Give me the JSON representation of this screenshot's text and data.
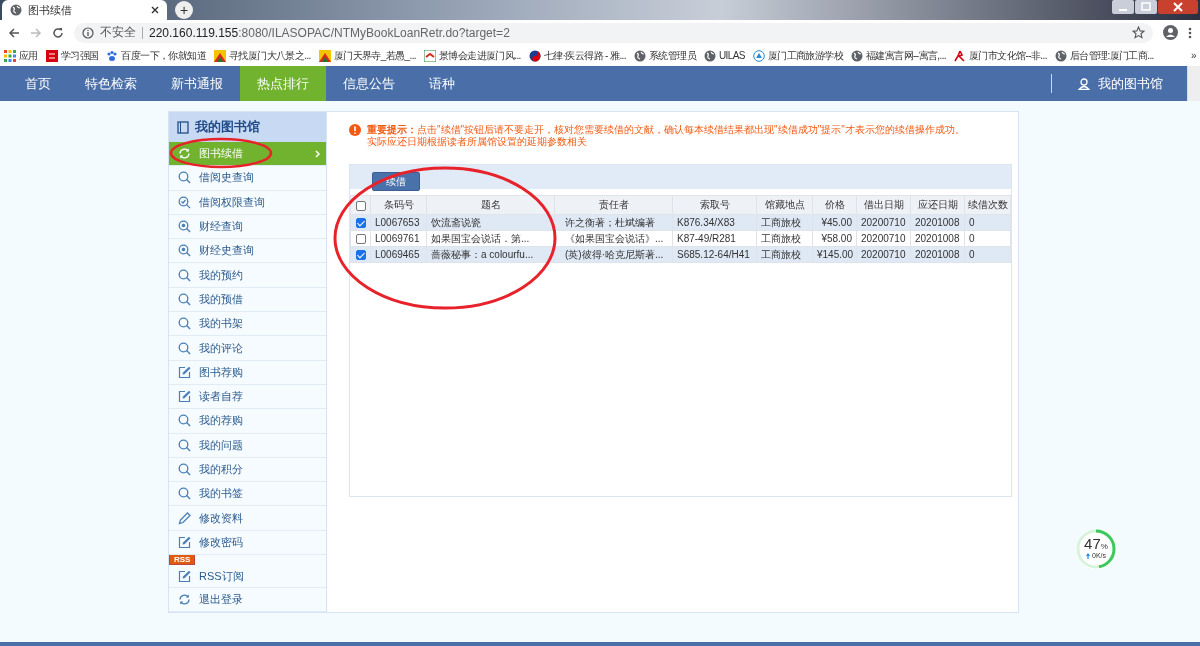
{
  "browser": {
    "tab_title": "图书续借",
    "new_tab": "+",
    "security": "不安全",
    "url_host": "220.160.119.155",
    "url_rest": ":8080/ILASOPAC/NTMyBookLoanRetr.do?target=2",
    "bookmarks": [
      {
        "label": "应用",
        "kind": "apps"
      },
      {
        "label": "学习强国",
        "kind": "red"
      },
      {
        "label": "百度一下，你就知道",
        "kind": "paw"
      },
      {
        "label": "寻找厦门大八景之...",
        "kind": "flag"
      },
      {
        "label": "厦门天界寺_若愚_...",
        "kind": "flag"
      },
      {
        "label": "景博会走进厦门风...",
        "kind": "green"
      },
      {
        "label": "七律·疾云得路 - 雅...",
        "kind": "swirl"
      },
      {
        "label": "系统管理员",
        "kind": "globe"
      },
      {
        "label": "UILAS",
        "kind": "globe"
      },
      {
        "label": "厦门工商旅游学校",
        "kind": "school"
      },
      {
        "label": "福建寓言网--寓言,...",
        "kind": "globe"
      },
      {
        "label": "厦门市文化馆--非...",
        "kind": "redlogo"
      },
      {
        "label": "后台管理:厦门工商...",
        "kind": "globe"
      }
    ],
    "overflow": "»"
  },
  "nav": {
    "items": [
      {
        "label": "首页",
        "selected": false
      },
      {
        "label": "特色检索",
        "selected": false
      },
      {
        "label": "新书通报",
        "selected": false
      },
      {
        "label": "热点排行",
        "selected": true
      },
      {
        "label": "信息公告",
        "selected": false
      },
      {
        "label": "语种",
        "selected": false
      }
    ],
    "account": "我的图书馆"
  },
  "sidebar": {
    "title": "我的图书馆",
    "items": [
      {
        "label": "图书续借",
        "kind": "renew",
        "selected": true
      },
      {
        "label": "借阅史查询",
        "kind": "search",
        "selected": false
      },
      {
        "label": "借阅权限查询",
        "kind": "check",
        "selected": false
      },
      {
        "label": "财经查询",
        "kind": "record",
        "selected": false
      },
      {
        "label": "财经史查询",
        "kind": "record",
        "selected": false
      },
      {
        "label": "我的预约",
        "kind": "search",
        "selected": false
      },
      {
        "label": "我的预借",
        "kind": "search",
        "selected": false
      },
      {
        "label": "我的书架",
        "kind": "search",
        "selected": false
      },
      {
        "label": "我的评论",
        "kind": "search",
        "selected": false
      },
      {
        "label": "图书荐购",
        "kind": "edit",
        "selected": false
      },
      {
        "label": "读者自荐",
        "kind": "edit",
        "selected": false
      },
      {
        "label": "我的荐购",
        "kind": "search",
        "selected": false
      },
      {
        "label": "我的问题",
        "kind": "search",
        "selected": false
      },
      {
        "label": "我的积分",
        "kind": "search",
        "selected": false
      },
      {
        "label": "我的书签",
        "kind": "search",
        "selected": false
      },
      {
        "label": "修改资料",
        "kind": "pencil",
        "selected": false
      },
      {
        "label": "修改密码",
        "kind": "edit",
        "selected": false
      },
      {
        "label": "RSS订阅",
        "kind": "edit",
        "selected": false,
        "badge": "RSS"
      },
      {
        "label": "退出登录",
        "kind": "refresh",
        "selected": false
      }
    ]
  },
  "notice": {
    "line1": "**重要提示：**点击\"续借\"按钮后请不要走开，核对您需要续借的文献，确认每本续借结果都出现\"续借成功\"提示\"才表示您的续借操作成功。",
    "line2": "实际应还日期根据读者所属馆设置的延期参数相关"
  },
  "renew_button": "续借",
  "table": {
    "all_checked": false,
    "columns": [
      "条码号",
      "题名",
      "责任者",
      "索取号",
      "馆藏地点",
      "价格",
      "借出日期",
      "应还日期",
      "续借次数"
    ],
    "rows": [
      {
        "checked": true,
        "cells": [
          "L0067653",
          "饮流斋说瓷",
          "许之衡著；杜斌编著",
          "K876.34/X83",
          "工商旅校",
          "¥45.00",
          "20200710",
          "20201008",
          "0"
        ]
      },
      {
        "checked": false,
        "cells": [
          "L0069761",
          "如果国宝会说话．第...",
          "《如果国宝会说话》...",
          "K87-49/R281",
          "工商旅校",
          "¥58.00",
          "20200710",
          "20201008",
          "0"
        ]
      },
      {
        "checked": true,
        "cells": [
          "L0069465",
          "蔷薇秘事：a colourfu...",
          "(英)彼得·哈克尼斯著...",
          "S685.12-64/H41",
          "工商旅校",
          "¥145.00",
          "20200710",
          "20201008",
          "0"
        ]
      }
    ]
  },
  "speed_widget": {
    "percent": "47",
    "unit": "%",
    "rate": "0K/s",
    "level": 0.47
  }
}
